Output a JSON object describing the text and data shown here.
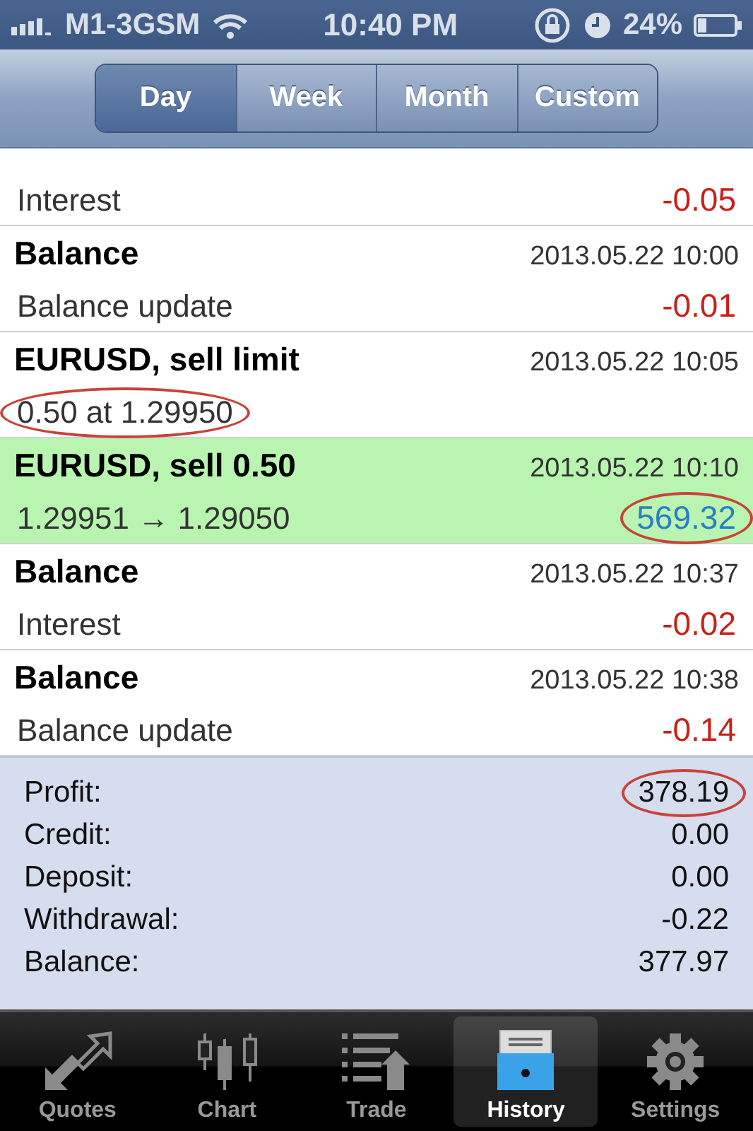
{
  "status_bar": {
    "carrier": "M1-3GSM",
    "time": "10:40 PM",
    "battery": "24%"
  },
  "segments": [
    {
      "label": "Day",
      "selected": true
    },
    {
      "label": "Week",
      "selected": false
    },
    {
      "label": "Month",
      "selected": false
    },
    {
      "label": "Custom",
      "selected": false
    }
  ],
  "rows": [
    {
      "subtitle": "Interest",
      "amount": "-0.05",
      "kind": "negative",
      "highlighted": false,
      "subtitle_circled": false,
      "amount_circled": false
    },
    {
      "title": "Balance",
      "time": "2013.05.22 10:00",
      "subtitle": "Balance update",
      "amount": "-0.01",
      "kind": "negative",
      "highlighted": false,
      "subtitle_circled": false,
      "amount_circled": false
    },
    {
      "title": "EURUSD, sell limit",
      "time": "2013.05.22 10:05",
      "subtitle": "0.50 at 1.29950",
      "highlighted": false,
      "subtitle_circled": true
    },
    {
      "title": "EURUSD, sell 0.50",
      "time": "2013.05.22 10:10",
      "subtitle": "1.29951 → 1.29050",
      "amount": "569.32",
      "kind": "positive",
      "highlighted": true,
      "subtitle_circled": false,
      "amount_circled": true
    },
    {
      "title": "Balance",
      "time": "2013.05.22 10:37",
      "subtitle": "Interest",
      "amount": "-0.02",
      "kind": "negative",
      "highlighted": false,
      "subtitle_circled": false,
      "amount_circled": false
    },
    {
      "title": "Balance",
      "time": "2013.05.22 10:38",
      "subtitle": "Balance update",
      "amount": "-0.14",
      "kind": "negative",
      "highlighted": false,
      "subtitle_circled": false,
      "amount_circled": false
    }
  ],
  "summary": [
    {
      "label": "Profit:",
      "value": "378.19",
      "circled": true
    },
    {
      "label": "Credit:",
      "value": "0.00",
      "circled": false
    },
    {
      "label": "Deposit:",
      "value": "0.00",
      "circled": false
    },
    {
      "label": "Withdrawal:",
      "value": "-0.22",
      "circled": false
    },
    {
      "label": "Balance:",
      "value": "377.97",
      "circled": false
    }
  ],
  "tab_bar": [
    {
      "label": "Quotes",
      "kind": "quotes",
      "selected": false
    },
    {
      "label": "Chart",
      "kind": "chart",
      "selected": false
    },
    {
      "label": "Trade",
      "kind": "trade",
      "selected": false
    },
    {
      "label": "History",
      "kind": "history",
      "selected": true
    },
    {
      "label": "Settings",
      "kind": "settings",
      "selected": false
    }
  ]
}
